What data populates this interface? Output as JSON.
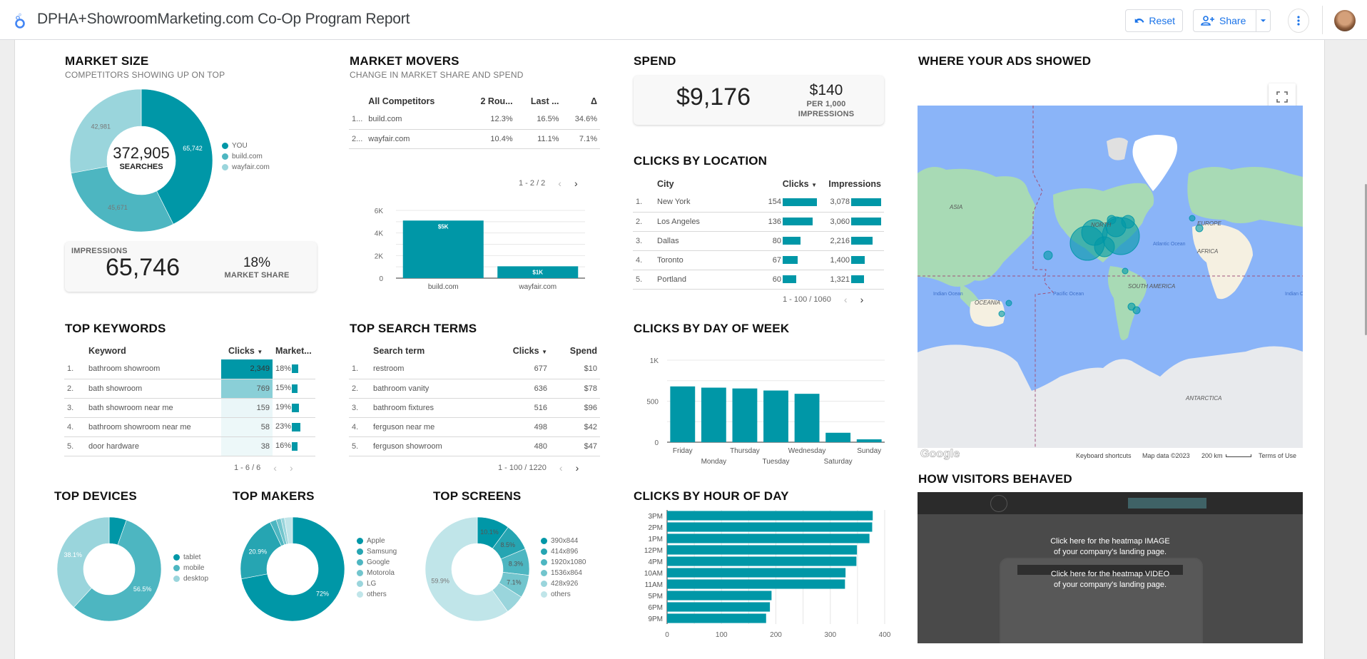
{
  "app": {
    "title": "DPHA+ShowroomMarketing.com Co-Op Program Report",
    "reset_label": "Reset",
    "share_label": "Share",
    "accent": "#1a73e8",
    "teal": "#0097a7"
  },
  "market_size": {
    "title": "MARKET SIZE",
    "subtitle": "COMPETITORS SHOWING UP ON TOP",
    "center_value": "372,905",
    "center_label": "SEARCHES",
    "chart_data": {
      "type": "pie",
      "categories": [
        "YOU",
        "build.com",
        "wayfair.com"
      ],
      "values": [
        65742,
        45671,
        42981
      ],
      "labels": [
        "65,742",
        "45,671",
        "42,981"
      ],
      "colors": [
        "#0097a7",
        "#4db6c1",
        "#9ad5dc"
      ]
    },
    "impressions_label": "IMPRESSIONS",
    "impressions_value": "65,746",
    "share_value": "18%",
    "share_label": "MARKET SHARE"
  },
  "market_movers": {
    "title": "MARKET MOVERS",
    "subtitle": "CHANGE IN MARKET SHARE AND SPEND",
    "columns": [
      "All Competitors",
      "2 Rou...",
      "Last ...",
      "Δ"
    ],
    "rows": [
      {
        "idx": "1...",
        "name": "build.com",
        "a": "12.3%",
        "b": "16.5%",
        "c": "34.6%"
      },
      {
        "idx": "2...",
        "name": "wayfair.com",
        "a": "10.4%",
        "b": "11.1%",
        "c": "7.1%"
      }
    ],
    "pager": "1 - 2 / 2",
    "chart_data": {
      "type": "bar",
      "categories": [
        "build.com",
        "wayfair.com"
      ],
      "values": [
        5100,
        1050
      ],
      "data_labels": [
        "$5K",
        "$1K"
      ],
      "yticks": [
        "0",
        "2K",
        "4K",
        "6K"
      ],
      "ylim": [
        0,
        6000
      ]
    }
  },
  "spend": {
    "title": "SPEND",
    "total": "$9,176",
    "cpm_value": "$140",
    "cpm_label1": "PER 1,000",
    "cpm_label2": "IMPRESSIONS"
  },
  "clicks_by_location": {
    "title": "CLICKS BY LOCATION",
    "columns": [
      "City",
      "Clicks",
      "Impressions"
    ],
    "rows": [
      {
        "idx": "1.",
        "city": "New York",
        "clicks": "154",
        "clicks_v": 154,
        "imps": "3,078",
        "imps_v": 3078
      },
      {
        "idx": "2.",
        "city": "Los Angeles",
        "clicks": "136",
        "clicks_v": 136,
        "imps": "3,060",
        "imps_v": 3060
      },
      {
        "idx": "3.",
        "city": "Dallas",
        "clicks": "80",
        "clicks_v": 80,
        "imps": "2,216",
        "imps_v": 2216
      },
      {
        "idx": "4.",
        "city": "Toronto",
        "clicks": "67",
        "clicks_v": 67,
        "imps": "1,400",
        "imps_v": 1400
      },
      {
        "idx": "5.",
        "city": "Portland",
        "clicks": "60",
        "clicks_v": 60,
        "imps": "1,321",
        "imps_v": 1321
      }
    ],
    "pager": "1 - 100 / 1060"
  },
  "top_keywords": {
    "title": "TOP KEYWORDS",
    "columns": [
      "Keyword",
      "Clicks",
      "Market..."
    ],
    "rows": [
      {
        "idx": "1.",
        "kw": "bathroom showroom",
        "clicks": "2,349",
        "heat": 1.0,
        "share": "18%",
        "share_v": 18
      },
      {
        "idx": "2.",
        "kw": "bath showroom",
        "clicks": "769",
        "heat": 0.4,
        "share": "15%",
        "share_v": 15
      },
      {
        "idx": "3.",
        "kw": "bath showroom near me",
        "clicks": "159",
        "heat": 0.12,
        "share": "19%",
        "share_v": 19
      },
      {
        "idx": "4.",
        "kw": "bathroom showroom near me",
        "clicks": "58",
        "heat": 0.06,
        "share": "23%",
        "share_v": 23
      },
      {
        "idx": "5.",
        "kw": "door hardware",
        "clicks": "38",
        "heat": 0.05,
        "share": "16%",
        "share_v": 16
      }
    ],
    "pager": "1 - 6 / 6"
  },
  "top_search_terms": {
    "title": "TOP SEARCH TERMS",
    "columns": [
      "Search term",
      "Clicks",
      "Spend"
    ],
    "rows": [
      {
        "idx": "1.",
        "term": "restroom",
        "clicks": "677",
        "spend": "$10"
      },
      {
        "idx": "2.",
        "term": "bathroom vanity",
        "clicks": "636",
        "spend": "$78"
      },
      {
        "idx": "3.",
        "term": "bathroom fixtures",
        "clicks": "516",
        "spend": "$96"
      },
      {
        "idx": "4.",
        "term": "ferguson near me",
        "clicks": "498",
        "spend": "$42"
      },
      {
        "idx": "5.",
        "term": "ferguson showroom",
        "clicks": "480",
        "spend": "$47"
      }
    ],
    "pager": "1 - 100 / 1220"
  },
  "clicks_by_day": {
    "title": "CLICKS BY DAY OF WEEK",
    "chart_data": {
      "type": "bar",
      "categories": [
        "Friday",
        "Monday",
        "Thursday",
        "Tuesday",
        "Wednesday",
        "Saturday",
        "Sunday"
      ],
      "values": [
        680,
        665,
        655,
        630,
        590,
        115,
        35
      ],
      "yticks": [
        "0",
        "500",
        "1K"
      ],
      "ylim": [
        0,
        1000
      ]
    }
  },
  "clicks_by_hour": {
    "title": "CLICKS BY HOUR OF DAY",
    "chart_data": {
      "type": "bar",
      "orientation": "horizontal",
      "categories": [
        "3PM",
        "2PM",
        "1PM",
        "12PM",
        "4PM",
        "10AM",
        "11AM",
        "5PM",
        "6PM",
        "9PM"
      ],
      "values": [
        378,
        377,
        372,
        349,
        348,
        328,
        327,
        192,
        189,
        182
      ],
      "xticks": [
        "0",
        "100",
        "200",
        "300",
        "400"
      ],
      "xlim": [
        0,
        400
      ]
    }
  },
  "top_devices": {
    "title": "TOP DEVICES",
    "chart_data": {
      "type": "pie",
      "categories": [
        "tablet",
        "mobile",
        "desktop"
      ],
      "values": [
        5.4,
        56.5,
        38.1
      ],
      "labels": [
        "",
        "56.5%",
        "38.1%"
      ],
      "colors": [
        "#0097a7",
        "#4db6c1",
        "#9ad5dc"
      ]
    }
  },
  "top_makers": {
    "title": "TOP MAKERS",
    "chart_data": {
      "type": "pie",
      "categories": [
        "Apple",
        "Samsung",
        "Google",
        "Motorola",
        "LG",
        "others"
      ],
      "values": [
        72,
        20.9,
        2.0,
        1.5,
        1.1,
        2.5
      ],
      "labels": [
        "72%",
        "20.9%",
        "",
        "",
        "",
        ""
      ],
      "colors": [
        "#0097a7",
        "#26a5b2",
        "#4db6c1",
        "#72c5cd",
        "#9ad5dc",
        "#c0e5e9"
      ]
    }
  },
  "top_screens": {
    "title": "TOP SCREENS",
    "chart_data": {
      "type": "pie",
      "categories": [
        "390x844",
        "414x896",
        "1920x1080",
        "1536x864",
        "428x926",
        "others"
      ],
      "values": [
        10.1,
        8.5,
        8.3,
        7.1,
        6.1,
        59.9
      ],
      "labels": [
        "10.1%",
        "8.5%",
        "8.3%",
        "7.1%",
        "",
        "59.9%"
      ],
      "colors": [
        "#0097a7",
        "#26a5b2",
        "#4db6c1",
        "#72c5cd",
        "#9ad5dc",
        "#c0e5e9"
      ]
    }
  },
  "map": {
    "title": "WHERE YOUR ADS SHOWED",
    "labels": [
      "ASIA",
      "EUROPE",
      "AFRICA",
      "NORTH",
      "SOUTH AMERICA",
      "OCEANIA",
      "ANTARCTICA",
      "Atlantic Ocean",
      "Pacific Ocean",
      "Indian Ocean",
      "Indian Ocean"
    ],
    "google_label": "Google",
    "footer": [
      "Keyboard shortcuts",
      "Map data ©2023",
      "200 km",
      "Terms of Use"
    ]
  },
  "visitors": {
    "title": "HOW VISITORS BEHAVED",
    "image_link_1": "Click here for the heatmap IMAGE",
    "image_link_2": "of your company's landing page.",
    "video_link_1": "Click here for the heatmap VIDEO",
    "video_link_2": "of your company's landing page."
  }
}
